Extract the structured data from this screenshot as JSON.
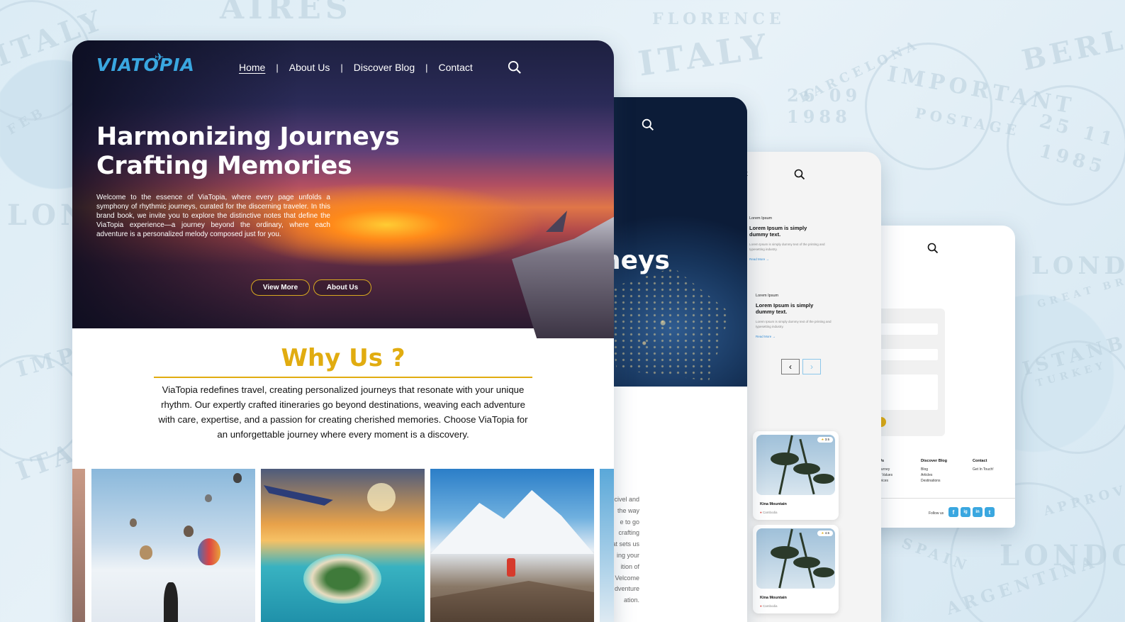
{
  "brand": {
    "logo": "VIATOPIA"
  },
  "nav": {
    "home": "Home",
    "about": "About Us",
    "blog": "Discover Blog",
    "contact": "Contact",
    "separator": "|"
  },
  "hero": {
    "title_line1": "Harmonizing Journeys",
    "title_line2": "Crafting Memories",
    "intro": "Welcome to the essence of ViaTopia, where every page unfolds a symphony of rhythmic journeys, curated for the discerning traveler. In this brand book, we invite you to explore the distinctive notes that define the ViaTopia experience—a journey beyond the ordinary, where each adventure is a personalized melody composed just for you.",
    "btn_view_more": "View More",
    "btn_about_us": "About Us"
  },
  "why": {
    "title": "Why Us ?",
    "text": "ViaTopia redefines travel, creating personalized journeys that resonate with your unique rhythm. Our expertly crafted itineraries go beyond destinations, weaving each adventure with care, expertise, and a passion for creating cherished memories. Choose ViaTopia for an unforgettable journey where every moment is a discovery."
  },
  "card2": {
    "big_text": "neys",
    "side_lines": [
      "civel and",
      "the way",
      "e to go",
      "crafting",
      "at sets us",
      "ing your",
      "ition of",
      "Velcome",
      "dventure",
      "ation."
    ]
  },
  "card3": {
    "nav_fragment": "t",
    "posts": [
      {
        "kicker": "Lorem Ipsum",
        "heading": "Lorem Ipsum is simply dummy text.",
        "desc": "Lorem Ipsum is simply dummy text of the printing and typesetting industry.",
        "read": "Read More"
      },
      {
        "kicker": "Lorem Ipsum",
        "heading": "Lorem Ipsum is simply dummy text.",
        "desc": "Lorem Ipsum is simply dummy text of the printing and typesetting industry.",
        "read": "Read More"
      }
    ],
    "prev": "‹",
    "next": "›",
    "tours": [
      {
        "title": "Kina Mountain",
        "location": "Cambodia",
        "rating": "3.5"
      },
      {
        "title": "Kina Mountain",
        "location": "Cambodia",
        "rating": "4.5"
      }
    ]
  },
  "card4": {
    "nav_fragment": "t",
    "footer": {
      "col1": {
        "head": "Us",
        "lines": [
          "ourney",
          "n Values",
          "rvices"
        ]
      },
      "col2": {
        "head": "Discover Blog",
        "lines": [
          "Blog",
          "Articles",
          "Destinations"
        ]
      },
      "col3": {
        "head": "Contact",
        "lines": [
          "Get In Touch!"
        ]
      },
      "follow": "Follow us",
      "socials": [
        "f",
        "ig",
        "in",
        "t"
      ]
    }
  },
  "background": {
    "stamps": [
      "AIRES",
      "FLORENCE",
      "ITALY",
      "BERLIN",
      "IMPORTANT",
      "POSTAGE",
      "BARCELONA",
      "26 09",
      "1988",
      "LONDON",
      "GREAT BRITAIN",
      "ISTANBUL",
      "TURKEY",
      "25 11",
      "1985",
      "APPROVED",
      "ARGENTINA",
      "SPAIN",
      "FEB"
    ]
  },
  "colors": {
    "accent": "#e1ac10",
    "brand_blue": "#3aa7e0"
  }
}
